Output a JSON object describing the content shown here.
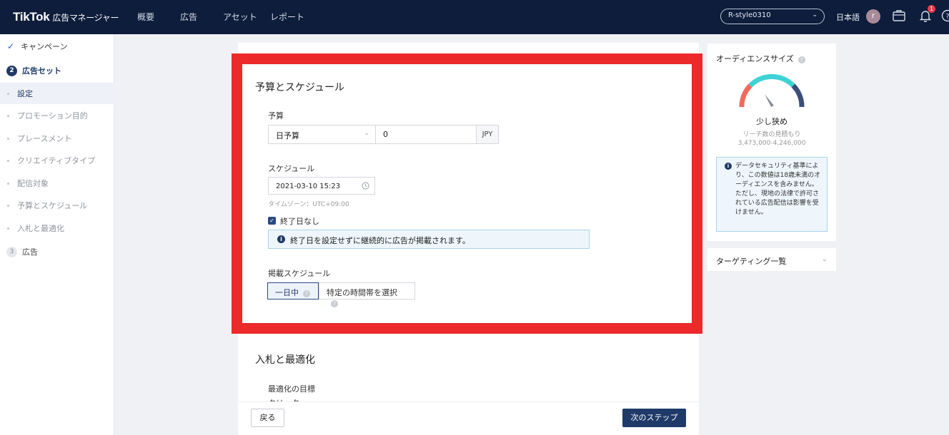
{
  "header": {
    "brand": "TikTok",
    "brand_sub": "広告マネージャー",
    "nav": [
      "概要",
      "広告",
      "アセット",
      "レポート"
    ],
    "account": "R-style0310",
    "language": "日本語",
    "avatar_initial": "r",
    "notification_count": "1"
  },
  "sidebar": {
    "steps": [
      {
        "label": "キャンペーン",
        "state": "done"
      },
      {
        "num": "2",
        "label": "広告セット",
        "state": "active"
      },
      {
        "num": "3",
        "label": "広告",
        "state": "inactive"
      }
    ],
    "sub_items": [
      "設定",
      "プロモーション目的",
      "プレースメント",
      "クリエイティブタイプ",
      "配信対象",
      "予算とスケジュール",
      "入札と最適化"
    ]
  },
  "budget_section": {
    "title": "予算とスケジュール",
    "budget_label": "予算",
    "budget_type": "日予算",
    "budget_value": "0",
    "currency": "JPY",
    "schedule_label": "スケジュール",
    "start_datetime": "2021-03-10 15:23",
    "timezone": "タイムゾーン：UTC+09:00",
    "no_end_date_label": "終了日なし",
    "info_text": "終了日を設定せずに継続的に広告が掲載されます。",
    "dayparting_label": "掲載スケジュール",
    "dayparting_options": [
      "一日中",
      "特定の時間帯を選択"
    ]
  },
  "bidding_section": {
    "title": "入札と最適化",
    "goal_label": "最適化の目標",
    "goal_value": "クリック"
  },
  "footer": {
    "back": "戻る",
    "next": "次のステップ"
  },
  "audience": {
    "title": "オーディエンスサイズ",
    "level": "少し狭め",
    "reach_label": "リーチ数の見積もり",
    "reach_range": "3,473,000-4,246,000",
    "security_note": "データセキュリティ基準により、この数値は18歳未満のオーディエンスを含みません。ただし、現地の法律で許可されている広告配信は影響を受けません。"
  },
  "targeting": {
    "label": "ターゲティング一覧"
  },
  "colors": {
    "nav_bg": "#0d1d3b",
    "primary": "#1f3a68",
    "highlight": "#ec2a2a",
    "info_bg": "#eef6fb"
  }
}
